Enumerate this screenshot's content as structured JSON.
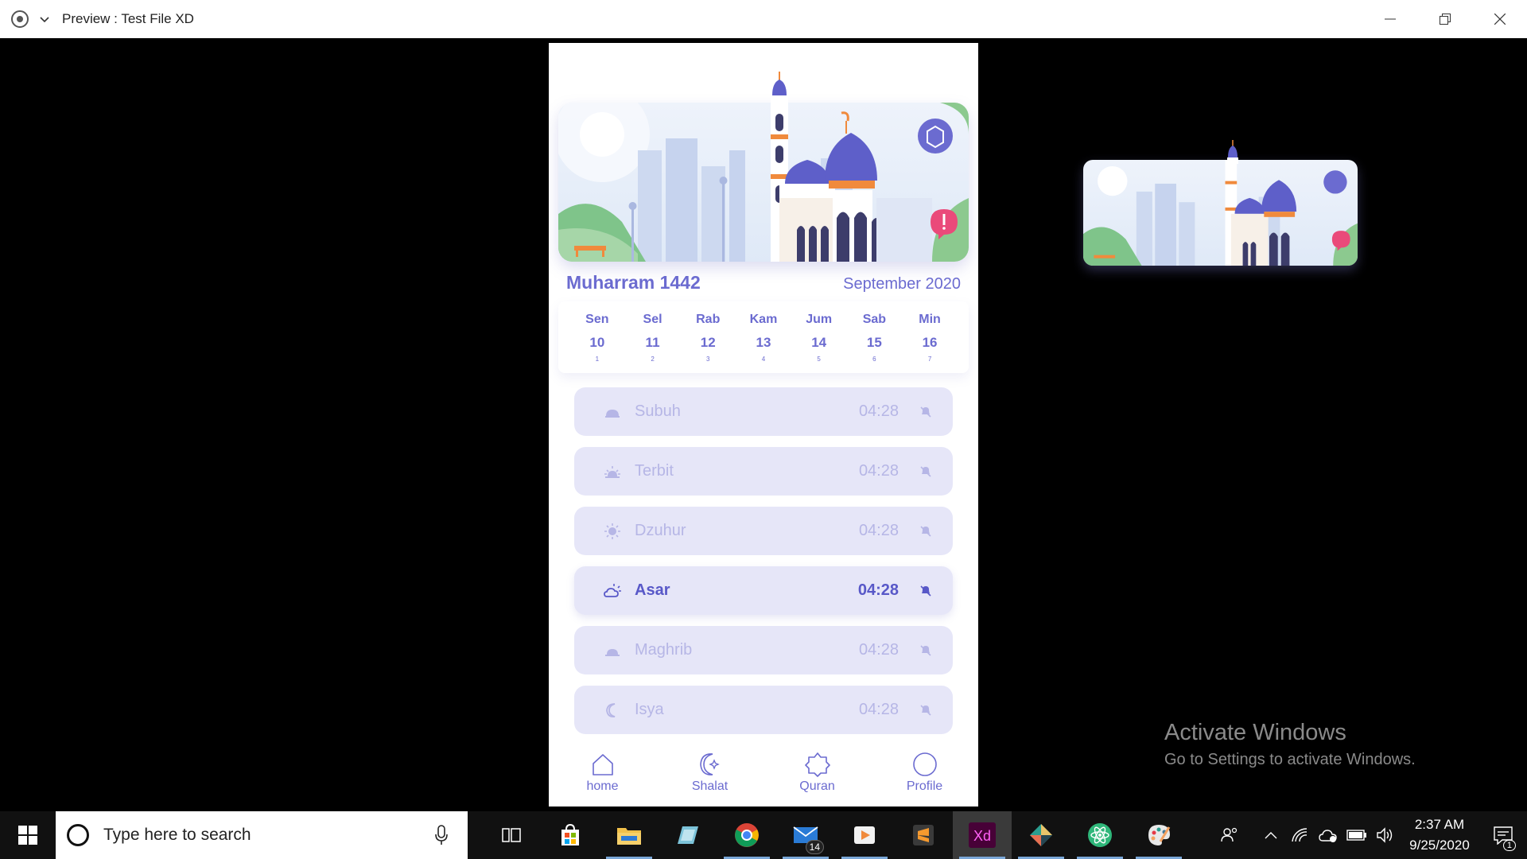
{
  "window": {
    "title": "Preview : Test File XD"
  },
  "app": {
    "hijri_month": "Muharram 1442",
    "gregorian_month": "September 2020",
    "week": [
      {
        "name": "Sen",
        "date": "10",
        "hijri": "1"
      },
      {
        "name": "Sel",
        "date": "11",
        "hijri": "2"
      },
      {
        "name": "Rab",
        "date": "12",
        "hijri": "3"
      },
      {
        "name": "Kam",
        "date": "13",
        "hijri": "4"
      },
      {
        "name": "Jum",
        "date": "14",
        "hijri": "5"
      },
      {
        "name": "Sab",
        "date": "15",
        "hijri": "6"
      },
      {
        "name": "Min",
        "date": "16",
        "hijri": "7"
      }
    ],
    "prayers": [
      {
        "name": "Subuh",
        "time": "04:28",
        "icon": "dawn-icon",
        "active": false
      },
      {
        "name": "Terbit",
        "time": "04:28",
        "icon": "sunrise-icon",
        "active": false
      },
      {
        "name": "Dzuhur",
        "time": "04:28",
        "icon": "sun-icon",
        "active": false
      },
      {
        "name": "Asar",
        "time": "04:28",
        "icon": "cloud-sun-icon",
        "active": true
      },
      {
        "name": "Maghrib",
        "time": "04:28",
        "icon": "sunset-icon",
        "active": false
      },
      {
        "name": "Isya",
        "time": "04:28",
        "icon": "moon-icon",
        "active": false
      }
    ],
    "nav": [
      {
        "label": "home",
        "icon": "home-icon"
      },
      {
        "label": "Shalat",
        "icon": "crescent-icon"
      },
      {
        "label": "Quran",
        "icon": "star-icon"
      },
      {
        "label": "Profile",
        "icon": "profile-icon"
      }
    ]
  },
  "watermark": {
    "title": "Activate Windows",
    "subtitle": "Go to Settings to activate Windows."
  },
  "taskbar": {
    "search_placeholder": "Type here to search",
    "mail_badge": "14",
    "xd_label": "Xd",
    "time": "2:37 AM",
    "date": "9/25/2020",
    "notification_count": "1"
  },
  "colors": {
    "accent": "#6b6bd0",
    "card": "#e6e6f8",
    "inactive_text": "#b6b6e6"
  }
}
